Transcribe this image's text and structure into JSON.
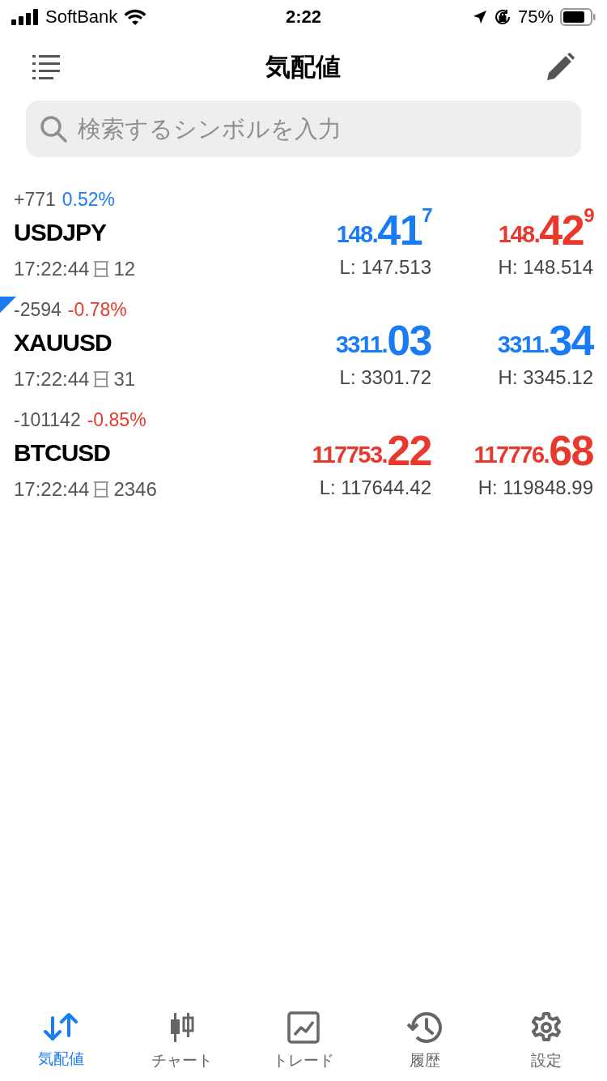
{
  "status_bar": {
    "carrier": "SoftBank",
    "time": "2:22",
    "battery": "75%"
  },
  "header": {
    "title": "気配値"
  },
  "search": {
    "placeholder": "検索するシンボルを入力"
  },
  "quotes": [
    {
      "change": "+771",
      "percent": "0.52%",
      "color": "#1a7cf5",
      "symbol": "USDJPY",
      "time": "17:22:44",
      "spread": "12",
      "selected": false,
      "bid": {
        "prefix": "148.",
        "main": "41",
        "sup": "7",
        "color": "#1a7cf5"
      },
      "ask": {
        "prefix": "148.",
        "main": "42",
        "sup": "9",
        "color": "#e8392c"
      },
      "low": "L: 147.513",
      "high": "H: 148.514"
    },
    {
      "change": "-2594",
      "percent": "-0.78%",
      "color": "#e8392c",
      "symbol": "XAUUSD",
      "time": "17:22:44",
      "spread": "31",
      "selected": true,
      "bid": {
        "prefix": "3311.",
        "main": "03",
        "color": "#1a7cf5"
      },
      "ask": {
        "prefix": "3311.",
        "main": "34",
        "color": "#1a7cf5"
      },
      "low": "L: 3301.72",
      "high": "H: 3345.12"
    },
    {
      "change": "-101142",
      "percent": "-0.85%",
      "color": "#e8392c",
      "symbol": "BTCUSD",
      "time": "17:22:44",
      "spread": "2346",
      "selected": false,
      "bid": {
        "prefix": "117753.",
        "main": "22",
        "color": "#e8392c"
      },
      "ask": {
        "prefix": "117776.",
        "main": "68",
        "color": "#e8392c"
      },
      "low": "L: 117644.42",
      "high": "H: 119848.99"
    }
  ],
  "tabs": [
    {
      "label": "気配値",
      "kind": "quotes",
      "selected": true
    },
    {
      "label": "チャート",
      "kind": "chart",
      "selected": false
    },
    {
      "label": "トレード",
      "kind": "trade",
      "selected": false
    },
    {
      "label": "履歴",
      "kind": "history",
      "selected": false
    },
    {
      "label": "設定",
      "kind": "settings",
      "selected": false
    }
  ]
}
